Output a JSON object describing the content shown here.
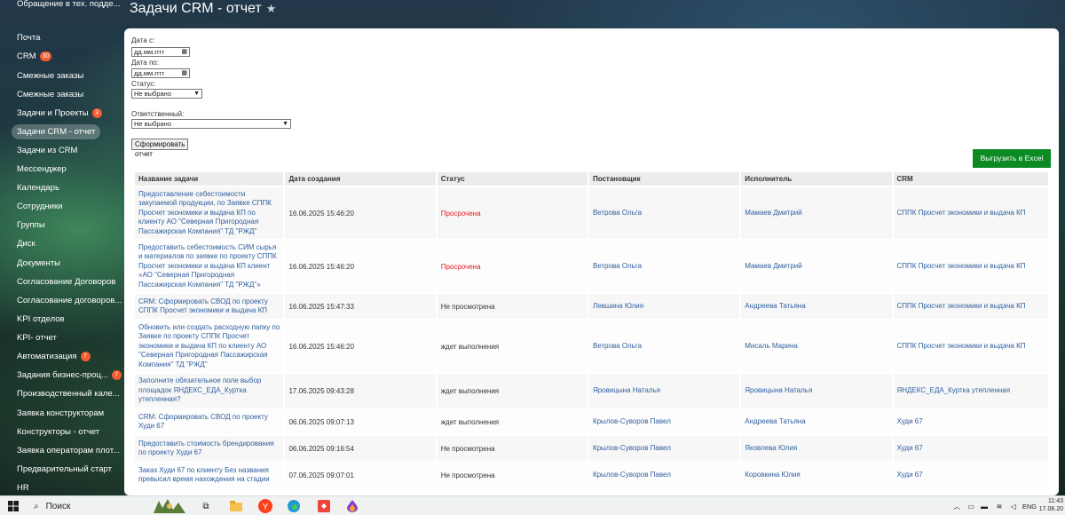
{
  "sidebar": {
    "items": [
      {
        "label": "Почта",
        "badge": ""
      },
      {
        "label": "CRM",
        "badge": "30"
      },
      {
        "label": "Смежные заказы",
        "badge": ""
      },
      {
        "label": "Смежные заказы",
        "badge": ""
      },
      {
        "label": "Задачи и Проекты",
        "badge": "3"
      },
      {
        "label": "Задачи CRM - отчет",
        "badge": ""
      },
      {
        "label": "Задачи из CRM",
        "badge": ""
      },
      {
        "label": "Мессенджер",
        "badge": ""
      },
      {
        "label": "Календарь",
        "badge": ""
      },
      {
        "label": "Сотрудники",
        "badge": ""
      },
      {
        "label": "Группы",
        "badge": ""
      },
      {
        "label": "Диск",
        "badge": ""
      },
      {
        "label": "Документы",
        "badge": ""
      },
      {
        "label": "Согласование Договоров",
        "badge": ""
      },
      {
        "label": "Согласование договоров...",
        "badge": ""
      },
      {
        "label": "KPI отделов",
        "badge": ""
      },
      {
        "label": "KPI- отчет",
        "badge": ""
      },
      {
        "label": "Автоматизация",
        "badge": "7"
      },
      {
        "label": "Задания бизнес-проц...",
        "badge": "7"
      },
      {
        "label": "Производственный кале...",
        "badge": ""
      },
      {
        "label": "Заявка конструкторам",
        "badge": ""
      },
      {
        "label": "Конструкторы - отчет",
        "badge": ""
      },
      {
        "label": "Заявка операторам плот...",
        "badge": ""
      },
      {
        "label": "Предварительный старт",
        "badge": ""
      },
      {
        "label": "HR",
        "badge": ""
      }
    ],
    "top_item": "Обращение в тех. подде..."
  },
  "page": {
    "title": "Задачи CRM - отчет"
  },
  "filters": {
    "date_from_label": "Дата с:",
    "date_from_value": "дд.мм.гггг",
    "date_to_label": "Дата по:",
    "date_to_value": "дд.мм.гггг",
    "status_label": "Статус:",
    "status_value": "Не выбрано",
    "responsible_label": "Ответственный:",
    "responsible_value": "Не выбрано",
    "generate_button": "Сформировать отчет"
  },
  "export_button": "Выгрузить в Excel",
  "table": {
    "headers": [
      "Название задачи",
      "Дата создания",
      "Статус",
      "Постановщик",
      "Исполнитель",
      "CRM"
    ],
    "rows": [
      {
        "name": "Предоставление себестоимости закупаемой продукции, по Заявке СППК Просчет экономики и выдача КП по клиенту АО \"Северная Пригородная Пассажирская Компания\" ТД \"РЖД\"",
        "date": "16.06.2025 15:46:20",
        "status": "Просрочена",
        "overdue": true,
        "creator": "Ветрова Ольга",
        "assignee": "Мамаев Дмитрий",
        "crm": "СППК Просчет экономики и выдача КП"
      },
      {
        "name": "Предоставить себестоимость СИМ сырья и материалов по заявке по проекту СППК Просчет экономики и выдача КП клиент «АО \"Северная Пригородная Пассажирская Компания\" ТД \"РЖД\"»",
        "date": "16.06.2025 15:46:20",
        "status": "Просрочена",
        "overdue": true,
        "creator": "Ветрова Ольга",
        "assignee": "Мамаев Дмитрий",
        "crm": "СППК Просчет экономики и выдача КП"
      },
      {
        "name": "CRM: Сформировать СВОД по проекту СППК Просчет экономики и выдача КП",
        "date": "16.06.2025 15:47:33",
        "status": "Не просмотрена",
        "overdue": false,
        "creator": "Левшина Юлия",
        "assignee": "Андреева Татьяна",
        "crm": "СППК Просчет экономики и выдача КП"
      },
      {
        "name": "Обновить или создать расходную папку по Заявке по проекту СППК Просчет экономики и выдача КП по клиенту АО \"Северная Пригородная Пассажирская Компания\" ТД \"РЖД\"",
        "date": "16.06.2025 15:46:20",
        "status": "ждет выполнения",
        "overdue": false,
        "creator": "Ветрова Ольга",
        "assignee": "Мисаль Марина",
        "crm": "СППК Просчет экономики и выдача КП"
      },
      {
        "name": "Заполните обязательное поле выбор площадок ЯНДЕКС_ЕДА_Куртка утепленная?",
        "date": "17.06.2025 09:43:28",
        "status": "ждет выполнения",
        "overdue": false,
        "creator": "Яровицына Наталья",
        "assignee": "Яровицына Наталья",
        "crm": "ЯНДЕКС_ЕДА_Куртка утепленная"
      },
      {
        "name": "CRM: Сформировать СВОД по проекту Худи 67",
        "date": "06.06.2025 09:07:13",
        "status": "ждет выполнения",
        "overdue": false,
        "creator": "Крылов-Суворов Павел",
        "assignee": "Андреева Татьяна",
        "crm": "Худи 67"
      },
      {
        "name": "Предоставить стоимость брендирования по проекту Худи 67",
        "date": "06.06.2025 09:16:54",
        "status": "Не просмотрена",
        "overdue": false,
        "creator": "Крылов-Суворов Павел",
        "assignee": "Яковлева Юлия",
        "crm": "Худи 67"
      },
      {
        "name": "Заказ Худи 67 по клиенту Без названия превысил время нахождения на стадии",
        "date": "07.06.2025 09:07:01",
        "status": "Не просмотрена",
        "overdue": false,
        "creator": "Крылов-Суворов Павел",
        "assignee": "Коровкина Юлия",
        "crm": "Худи 67"
      }
    ]
  },
  "taskbar": {
    "search_placeholder": "Поиск",
    "lang": "ENG",
    "time": "11:43",
    "date": "17.06.20"
  },
  "colors": {
    "link": "#2f5f9e",
    "overdue": "#e02020",
    "excel_button": "#0c8a23",
    "badge": "#f45b2f"
  }
}
